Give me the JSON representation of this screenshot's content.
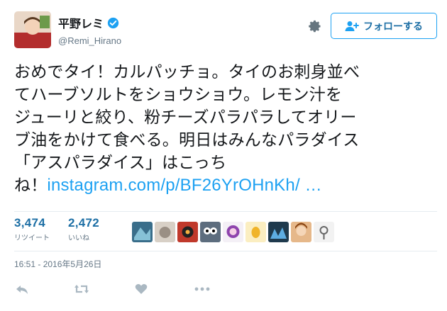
{
  "user": {
    "display_name": "平野レミ",
    "handle": "@Remi_Hirano",
    "verified_icon": "verified-badge-icon",
    "accent": "#1da1f2"
  },
  "follow_button": {
    "label": "フォローする",
    "icon": "person-plus-icon"
  },
  "tweet": {
    "text_lines": [
      "おめでタイ！カルパッチョ。タイのお刺身並べ",
      "てハーブソルトをショウショウ。レモン汁を",
      "ジューリと絞り、粉チーズパラパラしてオリー",
      "ブ油をかけて食べる。明日はみんなパラダイス",
      "「アスパラダイス」はこっち"
    ],
    "last_line_prefix": "ね！",
    "link_text": "instagram.com/p/BF26YrOHnKh/ …"
  },
  "stats": {
    "retweets": {
      "count": "3,474",
      "label": "リツイート"
    },
    "likes": {
      "count": "2,472",
      "label": "いいね"
    }
  },
  "likers": [
    "liker-avatar-1",
    "liker-avatar-2",
    "liker-avatar-3",
    "liker-avatar-4",
    "liker-avatar-5",
    "liker-avatar-6",
    "liker-avatar-7",
    "liker-avatar-8",
    "liker-avatar-9"
  ],
  "timestamp": "16:51 - 2016年5月26日",
  "actions": [
    "reply-icon",
    "retweet-icon",
    "like-icon",
    "more-icon"
  ]
}
